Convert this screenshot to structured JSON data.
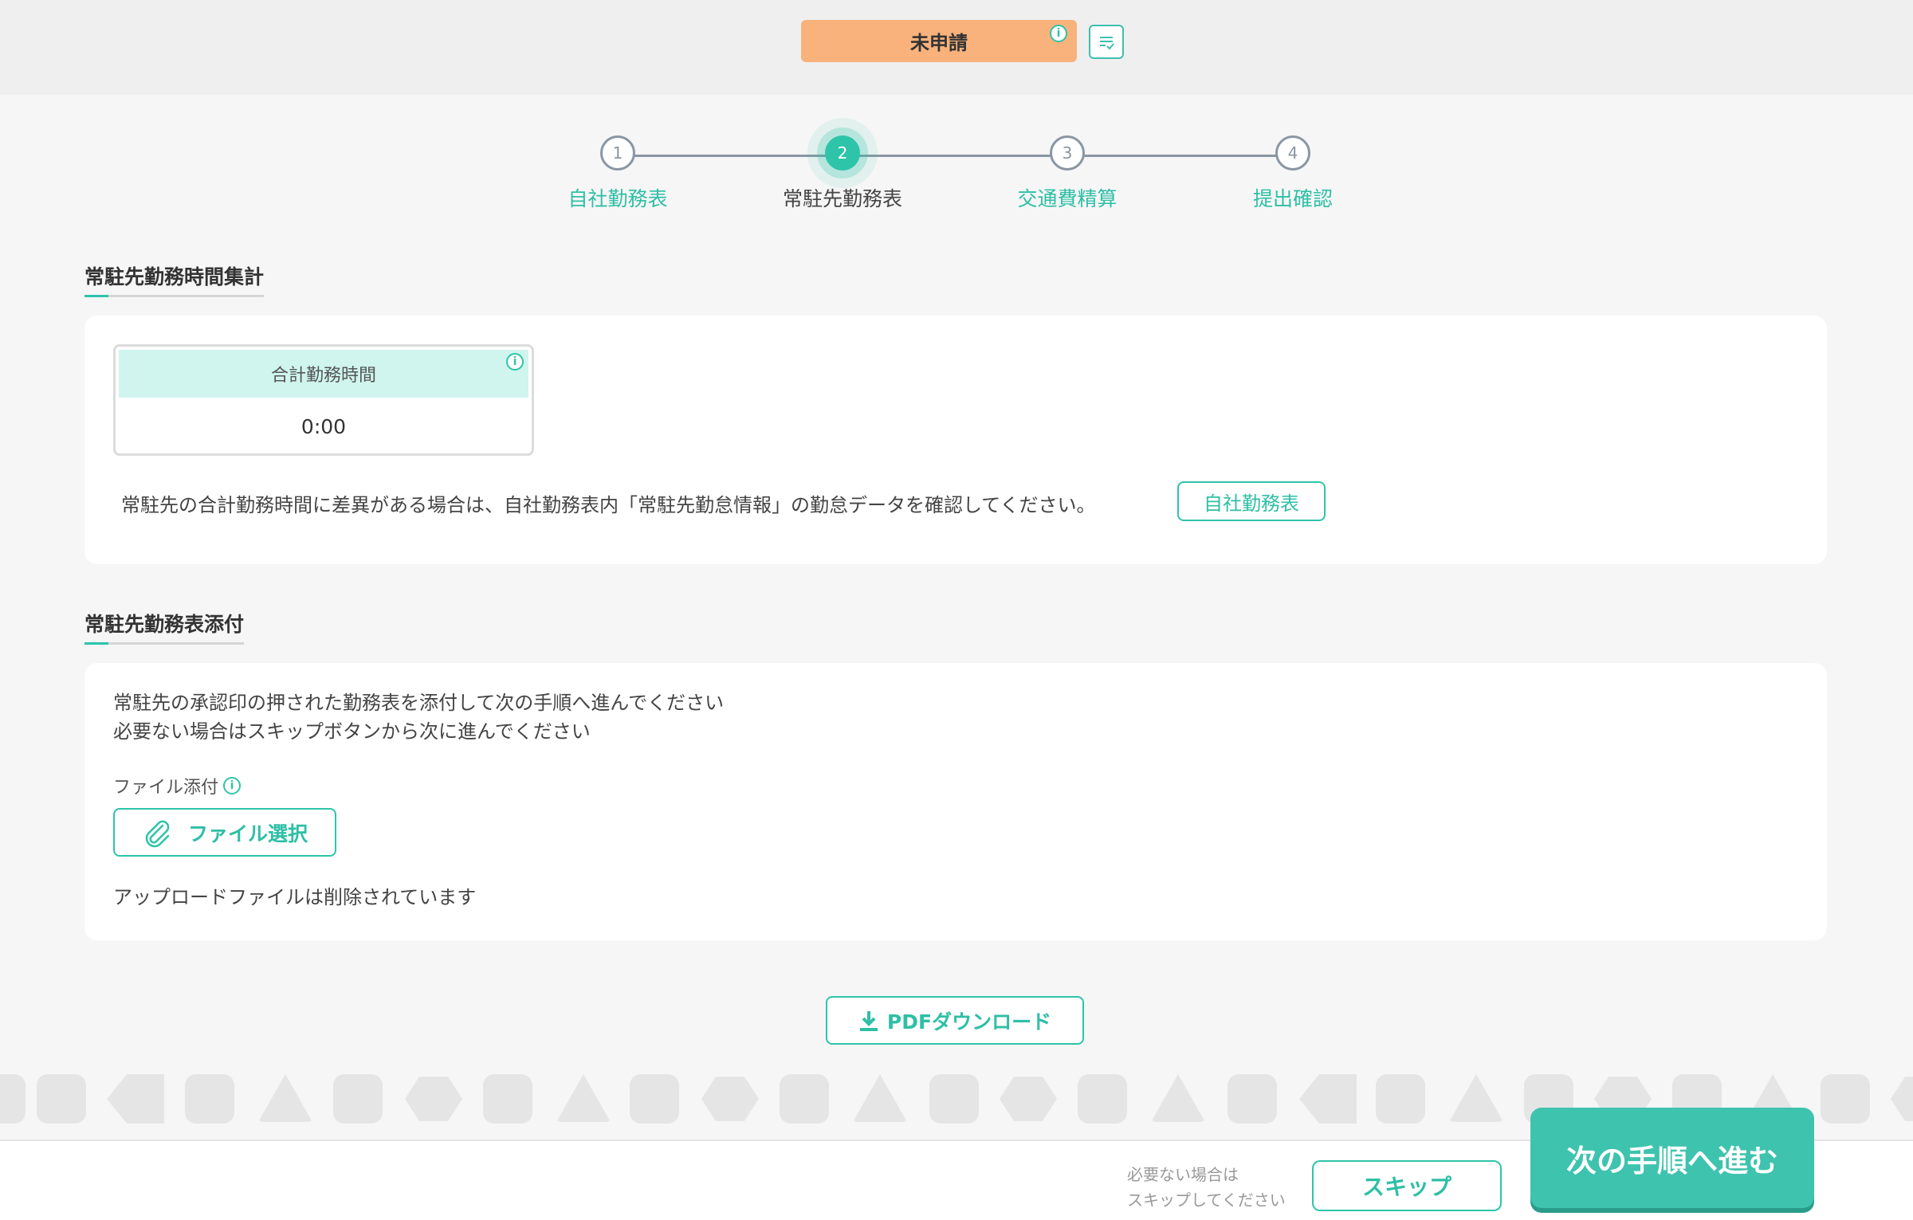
{
  "header": {
    "status_label": "未申請",
    "info_icon_glyph": "i",
    "memo_icon": "checklist-icon"
  },
  "stepper": {
    "steps": [
      {
        "number": "1",
        "label": "自社勤務表"
      },
      {
        "number": "2",
        "label": "常駐先勤務表"
      },
      {
        "number": "3",
        "label": "交通費精算"
      },
      {
        "number": "4",
        "label": "提出確認"
      }
    ],
    "active_step": 2
  },
  "summary_section": {
    "title": "常駐先勤務時間集計",
    "total_label": "合計勤務時間",
    "total_value": "0:00",
    "note": "常駐先の合計勤務時間に差異がある場合は、自社勤務表内「常駐先勤怠情報」の勤怠データを確認してください。",
    "company_timesheet_button": "自社勤務表"
  },
  "attachment_section": {
    "title": "常駐先勤務表添付",
    "description_line1": "常駐先の承認印の押された勤務表を添付して次の手順へ進んでください",
    "description_line2": "必要ない場合はスキップボタンから次に進んでください",
    "file_attach_label": "ファイル添付",
    "file_select_button": "ファイル選択",
    "upload_status": "アップロードファイルは削除されています"
  },
  "pdf_download_button": "PDFダウンロード",
  "footer": {
    "skip_note_line1": "必要ない場合は",
    "skip_note_line2": "スキップしてください",
    "skip_button": "スキップ",
    "next_button": "次の手順へ進む"
  },
  "colors": {
    "accent": "#2ec4a9",
    "status_badge": "#f9b27c",
    "total_header_bg": "#cff5ee",
    "next_button": "#3ec3ae"
  }
}
